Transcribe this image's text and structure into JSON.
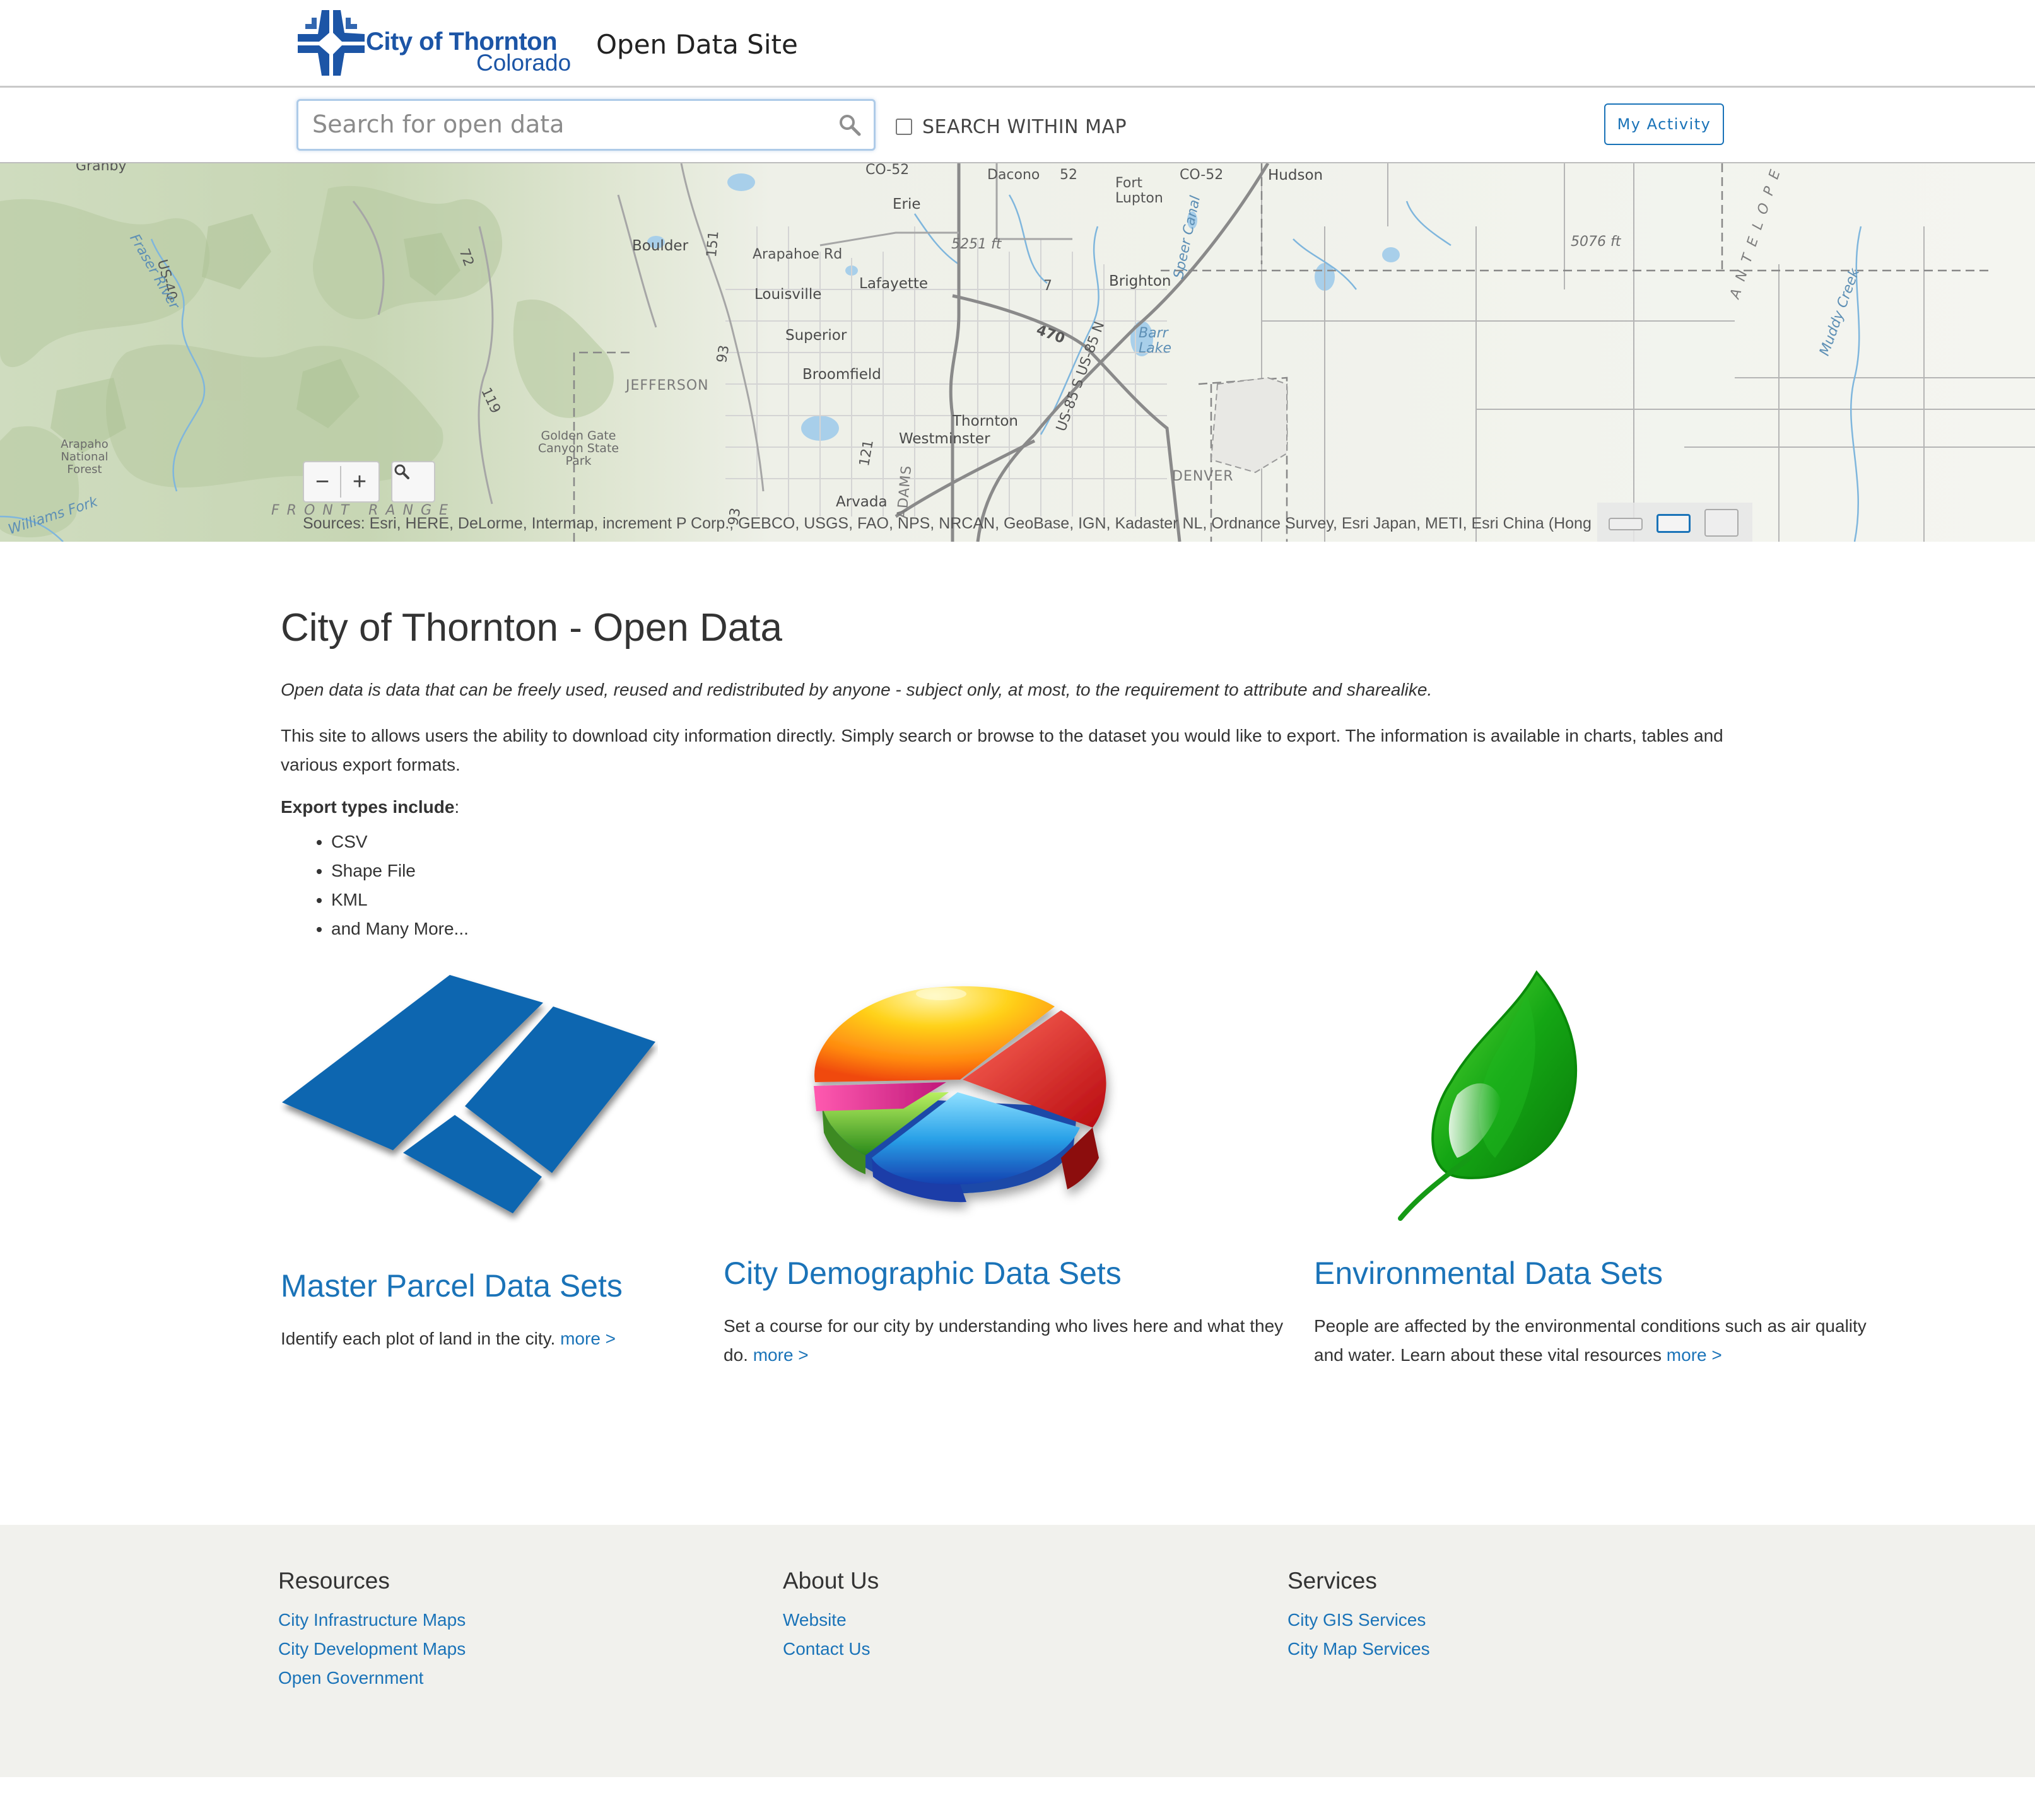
{
  "header": {
    "logo_name": "City of Thornton",
    "logo_sub": "Colorado",
    "site_name": "Open Data Site"
  },
  "search": {
    "placeholder": "Search for open data",
    "within_map_label": "SEARCH WITHIN MAP",
    "my_activity_label": "My Activity"
  },
  "map": {
    "labels": {
      "cr52": "CO-52",
      "dacono": "Dacono",
      "r52": "52",
      "fort_lupton": "Fort Lupton",
      "co52b": "CO-52",
      "hudson": "Hudson",
      "erie": "Erie",
      "boulder": "Boulder",
      "arapahoe_rd": "Arapahoe Rd",
      "elev1": "5251 ft",
      "elev2": "5076 ft",
      "lafayette": "Lafayette",
      "louisville": "Louisville",
      "brighton": "Brighton",
      "superior": "Superior",
      "broomfield": "Broomfield",
      "jefferson": "JEFFERSON",
      "barr_lake": "Barr Lake",
      "golden_gate": "Golden Gate Canyon State Park",
      "thornton": "Thornton",
      "westminster": "Westminster",
      "arapaho_nf": "Arapaho National Forest",
      "denver": "DENVER",
      "arvada": "Arvada",
      "front_range": "FRONT RANGE",
      "antelope": "ANTELOPE FLA",
      "muddy_creek": "Muddy Creek",
      "us40": "US-40",
      "r470": "470",
      "us85": "US-85 S US-85 N",
      "williams_fork": "Williams Fork",
      "r93": "93",
      "r119": "119",
      "r121": "121",
      "r72": "72",
      "r7": "7",
      "adams": "ADAMS",
      "granby": "Granby",
      "speer_canal": "Speer Canal",
      "fraser_river": "Fraser River",
      "r151": "151"
    },
    "zoom_out": "−",
    "zoom_in": "+",
    "attribution": "Sources: Esri, HERE, DeLorme, Intermap, increment P Corp., GEBCO, USGS, FAO, NPS, NRCAN, GeoBase, IGN, Kadaster NL, Ordnance Survey, Esri Japan, METI, Esri China (Hong Kong), swisstopo, MapmyIndia, © OpenStreetMap contributors, and the GIS User Community"
  },
  "content": {
    "title": "City of Thornton - Open Data",
    "intro": "Open data is data that can be freely used, reused and redistributed by anyone - subject only, at most, to the requirement to attribute and sharealike.",
    "description": "This site to allows users the ability to download city information directly. Simply search or browse to the dataset you would like to export. The information is available in charts, tables and various export formats.",
    "export_title": "Export types include",
    "export_colon": ":",
    "export_types": [
      "CSV",
      "Shape File",
      "KML",
      "and Many More..."
    ]
  },
  "cards": [
    {
      "title": "Master Parcel Data Sets",
      "text": "Identify each plot of land in the city.",
      "more": "more >"
    },
    {
      "title": "City Demographic Data Sets",
      "text": "Set a course for our city by understanding who lives here and what they do.",
      "more": "more >"
    },
    {
      "title": "Environmental Data Sets",
      "text": "People are affected by the environmental conditions such as air quality and water. Learn about these vital resources",
      "more": "more >"
    }
  ],
  "footer": {
    "resources": {
      "title": "Resources",
      "links": [
        "City Infrastructure Maps",
        "City Development Maps",
        "Open Government"
      ]
    },
    "about": {
      "title": "About Us",
      "links": [
        "Website",
        "Contact Us"
      ]
    },
    "services": {
      "title": "Services",
      "links": [
        "City GIS Services",
        "City Map Services"
      ]
    }
  },
  "colors": {
    "brand_blue": "#1c55a6",
    "link_blue": "#1a73b8",
    "footer_bg": "#f1f1ed"
  }
}
